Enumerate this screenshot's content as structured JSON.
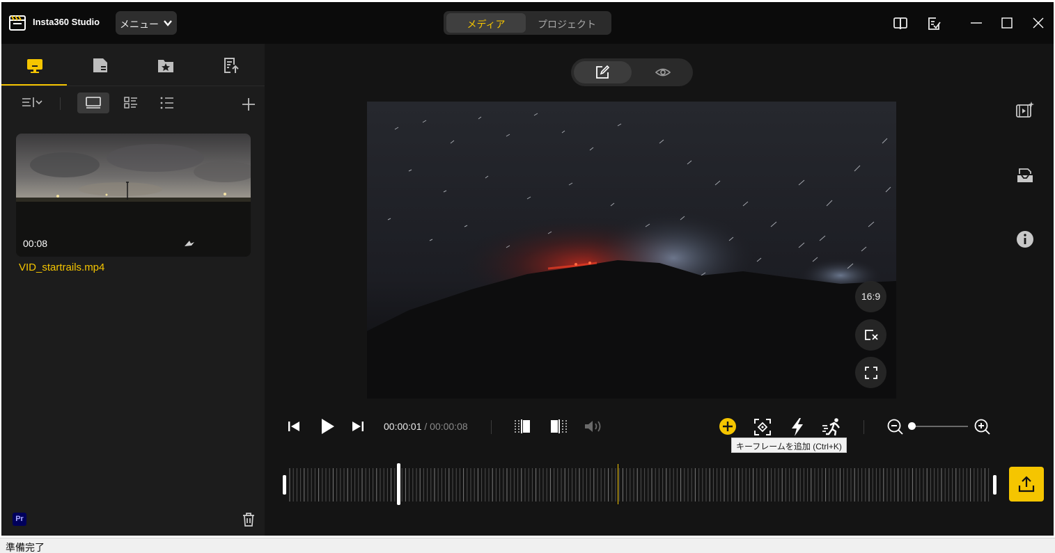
{
  "app": {
    "title": "Insta360 Studio",
    "menu_label": "メニュー",
    "accent_color": "#f5c500"
  },
  "mode_tabs": {
    "media": "メディア",
    "project": "プロジェクト",
    "selected": "media"
  },
  "titlebar_icons": [
    "book-icon",
    "checklist-icon"
  ],
  "window_controls": [
    "minimize",
    "maximize",
    "close"
  ],
  "left_panel": {
    "tabs": [
      {
        "icon": "monitor-icon",
        "active": true
      },
      {
        "icon": "sd-card-icon",
        "active": false
      },
      {
        "icon": "starred-folder-icon",
        "active": false
      },
      {
        "icon": "export-list-icon",
        "active": false
      }
    ],
    "view_modes": [
      "large-thumbnail",
      "grid",
      "list"
    ],
    "active_view_mode": "large-thumbnail",
    "files": [
      {
        "name": "VID_startrails.mp4",
        "duration": "00:08",
        "selected": true
      }
    ],
    "premiere_badge": "Pr"
  },
  "editor": {
    "mode_toggle": [
      "edit",
      "preview"
    ],
    "active_mode": "edit",
    "aspect_ratio": "16:9"
  },
  "right_sidebar_icons": [
    "video-effects-icon",
    "template-icon",
    "info-icon"
  ],
  "playback": {
    "current_time": "00:00:01",
    "total_time": "00:00:08",
    "time_separator": " / ",
    "tooltip": "キーフレームを追加 (Ctrl+K)",
    "zoom_level": 0
  },
  "timeline": {
    "playhead_fraction": 0.47,
    "trim_position_fraction": 0.16
  },
  "status_bar": {
    "text": "準備完了"
  }
}
